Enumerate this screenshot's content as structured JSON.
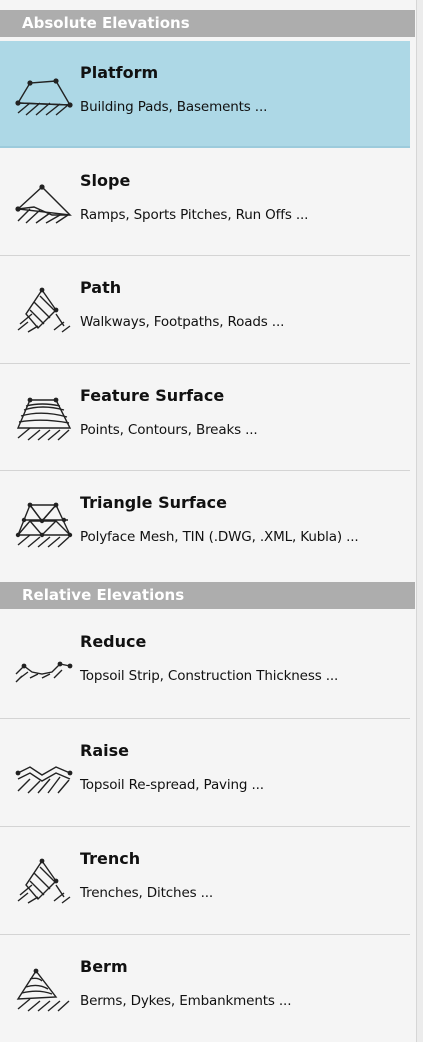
{
  "absolute_section": {
    "header": "Absolute Elevations",
    "items": [
      {
        "title": "Platform",
        "description": "Building Pads, Basements ...",
        "icon": "platform-icon"
      },
      {
        "title": "Slope",
        "description": "Ramps, Sports Pitches, Run Offs ...",
        "icon": "slope-icon"
      },
      {
        "title": "Path",
        "description": "Walkways, Footpaths, Roads ...",
        "icon": "path-icon"
      },
      {
        "title": "Feature Surface",
        "description": "Points, Contours, Breaks ...",
        "icon": "feature-surface-icon"
      },
      {
        "title": "Triangle Surface",
        "description": "Polyface Mesh, TIN (.DWG, .XML, Kubla) ...",
        "icon": "triangle-surface-icon"
      }
    ]
  },
  "relative_section": {
    "header": "Relative Elevations",
    "items": [
      {
        "title": "Reduce",
        "description": "Topsoil Strip, Construction Thickness ...",
        "icon": "reduce-icon"
      },
      {
        "title": "Raise",
        "description": "Topsoil Re-spread, Paving ...",
        "icon": "raise-icon"
      },
      {
        "title": "Trench",
        "description": "Trenches, Ditches ...",
        "icon": "trench-icon"
      },
      {
        "title": "Berm",
        "description": "Berms, Dykes, Embankments ...",
        "icon": "berm-icon"
      }
    ]
  },
  "colors": {
    "selected_background": "#add8e6",
    "section_header": "#adadad"
  },
  "selected_item": "Platform"
}
